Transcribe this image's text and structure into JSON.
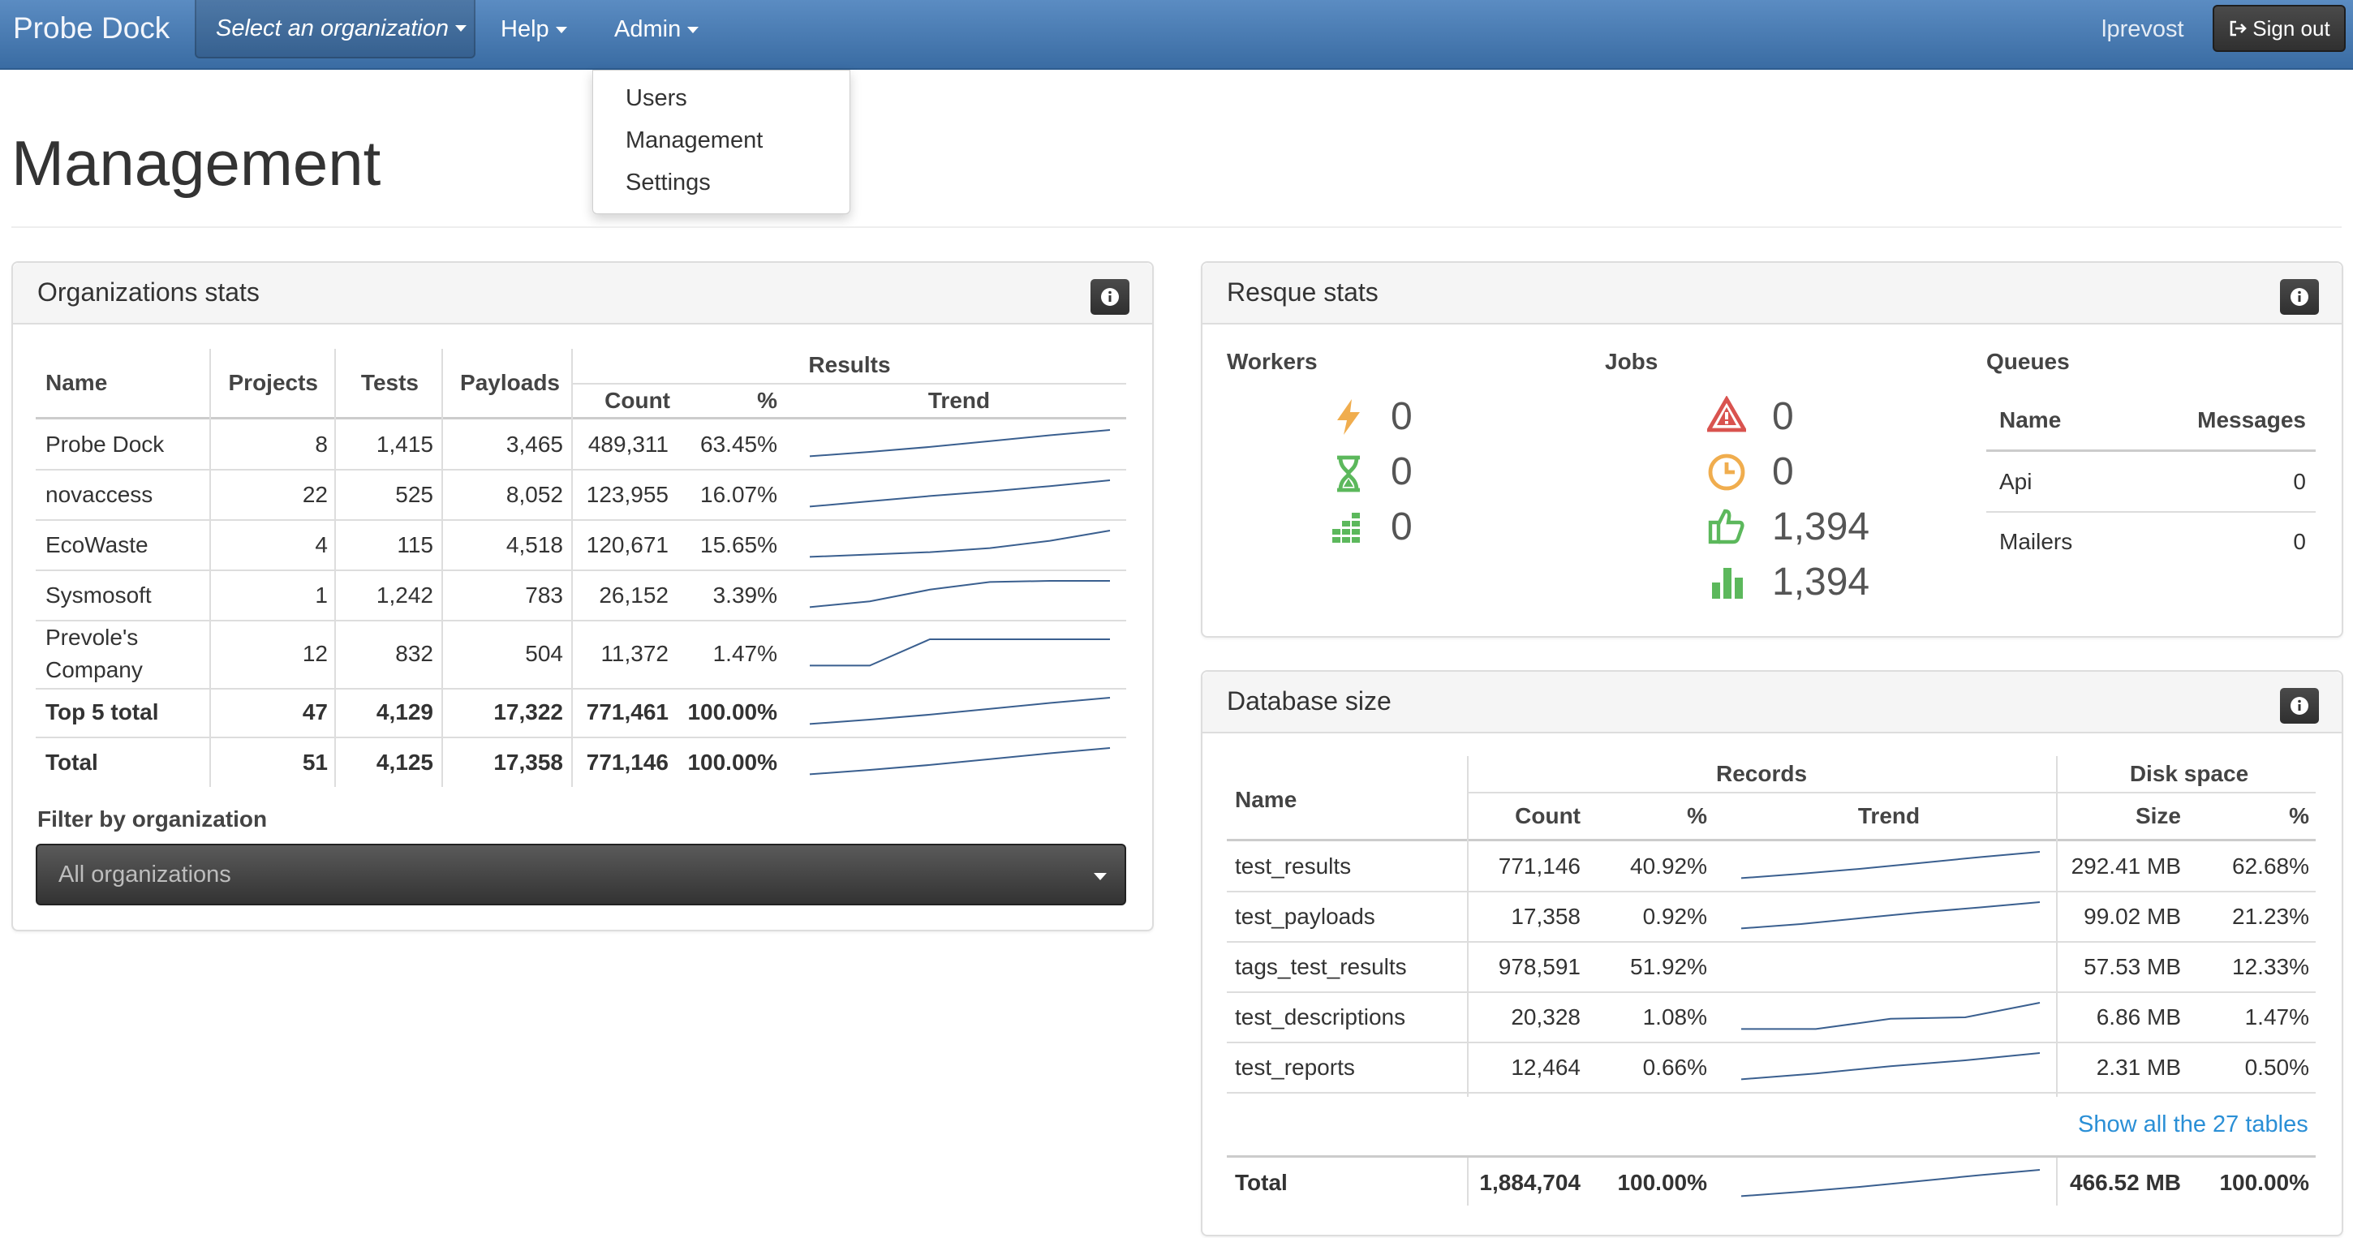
{
  "navbar": {
    "brand": "Probe Dock",
    "org_select": "Select an organization",
    "help": "Help",
    "admin": "Admin",
    "user": "lprevost",
    "sign_out": "Sign out"
  },
  "admin_menu": [
    "Users",
    "Management",
    "Settings"
  ],
  "page": {
    "title": "Management"
  },
  "org_stats": {
    "title": "Organizations stats",
    "headers": {
      "name": "Name",
      "projects": "Projects",
      "tests": "Tests",
      "payloads": "Payloads",
      "results": "Results",
      "count": "Count",
      "percent": "%",
      "trend": "Trend"
    },
    "rows": [
      {
        "name": "Probe Dock",
        "projects": "8",
        "tests": "1,415",
        "payloads": "3,465",
        "count": "489,311",
        "percent": "63.45%",
        "trend": [
          10,
          25,
          42,
          62,
          82,
          100
        ]
      },
      {
        "name": "novaccess",
        "projects": "22",
        "tests": "525",
        "payloads": "8,052",
        "count": "123,955",
        "percent": "16.07%",
        "trend": [
          10,
          28,
          46,
          62,
          80,
          100
        ]
      },
      {
        "name": "EcoWaste",
        "projects": "4",
        "tests": "115",
        "payloads": "4,518",
        "count": "120,671",
        "percent": "15.65%",
        "trend": [
          10,
          18,
          26,
          40,
          65,
          100
        ]
      },
      {
        "name": "Sysmosoft",
        "projects": "1",
        "tests": "1,242",
        "payloads": "783",
        "count": "26,152",
        "percent": "3.39%",
        "trend": [
          10,
          30,
          70,
          96,
          100,
          100
        ]
      },
      {
        "name_line1": "Prevole's",
        "name_line2": "Company",
        "projects": "12",
        "tests": "832",
        "payloads": "504",
        "count": "11,372",
        "percent": "1.47%",
        "trend": [
          10,
          10,
          100,
          100,
          100,
          100
        ]
      },
      {
        "name": "Top 5 total",
        "projects": "47",
        "tests": "4,129",
        "payloads": "17,322",
        "count": "771,461",
        "percent": "100.00%",
        "trend": [
          10,
          25,
          42,
          62,
          82,
          100
        ]
      },
      {
        "name": "Total",
        "projects": "51",
        "tests": "4,125",
        "payloads": "17,358",
        "count": "771,146",
        "percent": "100.00%",
        "trend": [
          10,
          25,
          42,
          62,
          82,
          100
        ]
      }
    ],
    "filter_label": "Filter by organization",
    "filter_value": "All organizations"
  },
  "resque": {
    "title": "Resque stats",
    "workers": {
      "heading": "Workers",
      "values": [
        "0",
        "0",
        "0"
      ],
      "icons": [
        "bolt-icon",
        "hourglass-icon",
        "workers-grid-icon"
      ]
    },
    "jobs": {
      "heading": "Jobs",
      "values": [
        "0",
        "0",
        "1,394",
        "1,394"
      ],
      "icons": [
        "warning-icon",
        "clock-icon",
        "thumbs-up-icon",
        "bar-chart-icon"
      ]
    },
    "queues": {
      "heading": "Queues",
      "headers": {
        "name": "Name",
        "messages": "Messages"
      },
      "rows": [
        {
          "name": "Api",
          "messages": "0"
        },
        {
          "name": "Mailers",
          "messages": "0"
        }
      ]
    }
  },
  "database": {
    "title": "Database size",
    "headers": {
      "name": "Name",
      "records": "Records",
      "disk_space": "Disk space",
      "count": "Count",
      "percent": "%",
      "trend": "Trend",
      "size": "Size"
    },
    "rows": [
      {
        "name": "test_results",
        "count": "771,146",
        "percent": "40.92%",
        "size": "292.41 MB",
        "disk_percent": "62.68%",
        "trend": [
          10,
          25,
          42,
          62,
          82,
          100
        ]
      },
      {
        "name": "test_payloads",
        "count": "17,358",
        "percent": "0.92%",
        "size": "99.02 MB",
        "disk_percent": "21.23%",
        "trend": [
          10,
          25,
          45,
          65,
          82,
          100
        ]
      },
      {
        "name": "tags_test_results",
        "count": "978,591",
        "percent": "51.92%",
        "size": "57.53 MB",
        "disk_percent": "12.33%",
        "trend": []
      },
      {
        "name": "test_descriptions",
        "count": "20,328",
        "percent": "1.08%",
        "size": "6.86 MB",
        "disk_percent": "1.47%",
        "trend": [
          10,
          10,
          45,
          50,
          100
        ]
      },
      {
        "name": "test_reports",
        "count": "12,464",
        "percent": "0.66%",
        "size": "2.31 MB",
        "disk_percent": "0.50%",
        "trend": [
          10,
          30,
          55,
          75,
          100
        ]
      }
    ],
    "show_all_link": "Show all the 27 tables",
    "total": {
      "name": "Total",
      "count": "1,884,704",
      "percent": "100.00%",
      "size": "466.52 MB",
      "disk_percent": "100.00%",
      "trend": [
        10,
        25,
        42,
        62,
        82,
        100
      ]
    }
  },
  "colors": {
    "navbar": "#4a7db4",
    "trend_line": "#3a5f8f",
    "orange": "#f0ad4e",
    "green": "#5cb85c",
    "red": "#d9534f",
    "link": "#2a8fd6"
  }
}
